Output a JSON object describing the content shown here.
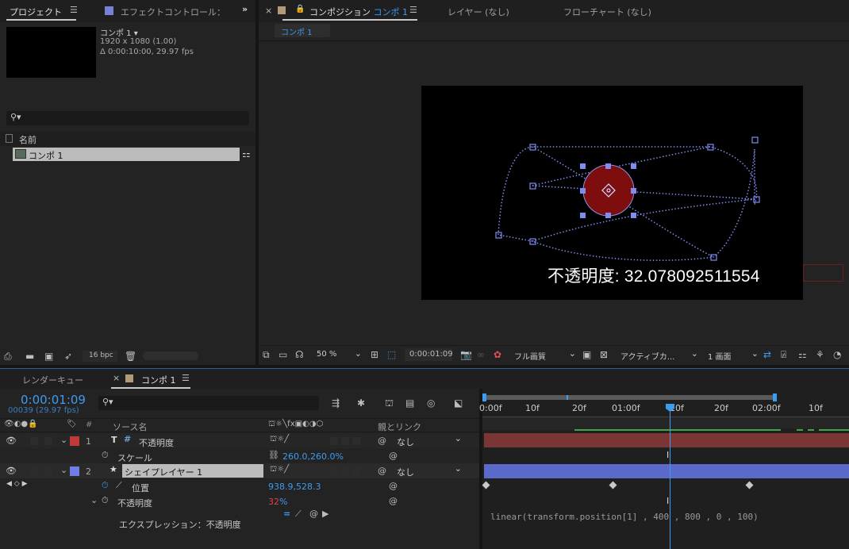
{
  "project_panel": {
    "tab_label": "プロジェクト",
    "effect_tab_label": "エフェクトコントロール：",
    "comp_name": "コンポ 1",
    "dimensions": "1920 x 1080 (1.00)",
    "duration": "Δ 0:00:10:00, 29.97 fps",
    "search_placeholder": "",
    "col_name": "名前",
    "item_name": "コンポ 1",
    "bpc": "16 bpc"
  },
  "comp_panel": {
    "tab_label": "コンポジション",
    "tab_comp_name": "コンポ 1",
    "layer_tab": "レイヤー (なし)",
    "flowchart_tab": "フローチャート (なし)",
    "breadcrumb": "コンポ 1",
    "overlay_text": "不透明度: 32.078092511554",
    "zoom": "50 %",
    "timecode": "0:00:01:09",
    "resolution": "フル画質",
    "camera": "アクティブカ...",
    "views": "1 画面"
  },
  "timeline": {
    "render_queue_tab": "レンダーキュー",
    "comp_tab": "コンポ 1",
    "current_time": "0:00:01:09",
    "frame_info": "00039 (29.97 fps)",
    "col_source": "ソース名",
    "col_parent": "親とリンク",
    "ruler_labels": [
      "0:00f",
      "10f",
      "20f",
      "01:00f",
      "10f",
      "20f",
      "02:00f",
      "10f"
    ],
    "layers": [
      {
        "num": "1",
        "name": "不透明度",
        "color": "#c03a3a",
        "type_icon": "T",
        "parent": "なし"
      },
      {
        "num": "2",
        "name": "シェイプレイヤー 1",
        "color": "#6f7ee0",
        "type_icon": "★",
        "parent": "なし"
      }
    ],
    "prop_scale_label": "スケール",
    "prop_scale_value": "260.0,260.0%",
    "prop_position_label": "位置",
    "prop_position_value": "938.9,528.3",
    "prop_opacity_label": "不透明度",
    "prop_opacity_value": "32",
    "prop_opacity_unit": "%",
    "expression_label": "エクスプレッション：不透明度",
    "expression_code": "linear(transform.position[1] , 400 , 800 , 0 , 100)"
  },
  "colors": {
    "accent_blue": "#3d9bf0",
    "layer1_bar": "#7a3535",
    "layer2_bar": "#5b69c9"
  }
}
